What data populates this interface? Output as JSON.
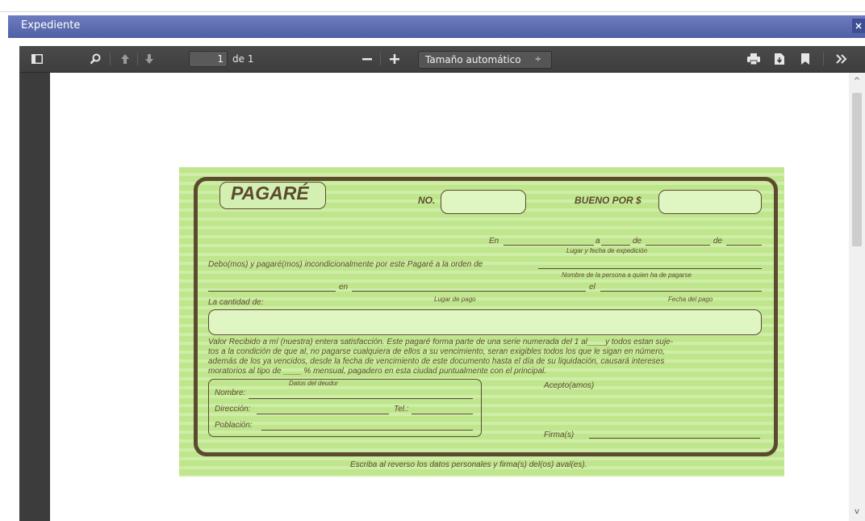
{
  "window": {
    "title": "Expediente",
    "close_icon": "×"
  },
  "toolbar": {
    "page_number": "1",
    "page_of": "de 1",
    "zoom": "Tamaño automático",
    "zoom_caret": "÷"
  },
  "scrollbar": {
    "up_arrow": "^",
    "down_arrow": "v"
  },
  "document": {
    "title": "PAGARÉ",
    "no_label": "NO.",
    "bueno_label": "BUENO POR $",
    "en": "En",
    "a": "a",
    "de": "de",
    "de2": "de",
    "lugar_fecha": "Lugar y fecha de expedición",
    "debo_text": "Debo(mos) y pagaré(mos) incondicionalmente por este Pagaré a la orden de",
    "nombre_persona": "Nombre de la persona a quien ha de pagarse",
    "en2": "en",
    "el": "el",
    "cantidad_label": "La cantidad de:",
    "lugar_pago": "Lugar de pago",
    "fecha_pago": "Fecha del pago",
    "clause": [
      "Valor Recibido a mí (nuestra) entera satisfacción. Este pagaré forma parte de una serie numerada del 1 al____y todos estan suje-",
      "tos a la condición de que al, no pagarse cualquiera de ellos a su vencimiento, seran exigibles todos los que le sigan en número,",
      "además de los ya vencidos, desde la fecha de vencimiento de este documento hasta el día de su liquidación, causará intereses",
      "moratorios al tipo de ____ % mensual, pagadero en esta ciudad puntualmente con el principal."
    ],
    "datos_deudor": "Datos del deudor",
    "nombre": "Nombre:",
    "direccion": "Dirección:",
    "tel": "Tel.:",
    "poblacion": "Población:",
    "acepto": "Acepto(amos)",
    "firma": "Firma(s)",
    "footer": "Escriba al reverso los datos personales y firma(s) del(os) aval(es)."
  }
}
